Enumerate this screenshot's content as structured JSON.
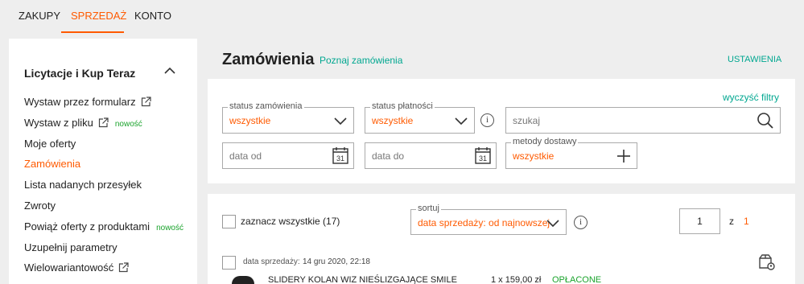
{
  "top_nav": {
    "tabs": [
      {
        "label": "ZAKUPY"
      },
      {
        "label": "SPRZEDAŻ"
      },
      {
        "label": "KONTO"
      }
    ]
  },
  "sidebar": {
    "title": "Licytacje i Kup Teraz",
    "items": [
      {
        "label": "Wystaw przez formularz"
      },
      {
        "label": "Wystaw z pliku",
        "badge": "nowość"
      },
      {
        "label": "Moje oferty"
      },
      {
        "label": "Zamówienia"
      },
      {
        "label": "Lista nadanych przesyłek"
      },
      {
        "label": "Zwroty"
      },
      {
        "label": "Powiąż oferty z produktami",
        "badge": "nowość"
      },
      {
        "label": "Uzupełnij parametry"
      },
      {
        "label": "Wielowariantowość"
      }
    ]
  },
  "header": {
    "title": "Zamówienia",
    "learn_link": "Poznaj zamówienia",
    "settings_link": "USTAWIENIA"
  },
  "filters": {
    "clear_label": "wyczyść filtry",
    "order_status": {
      "label": "status zamówienia",
      "value": "wszystkie"
    },
    "payment_status": {
      "label": "status płatności",
      "value": "wszystkie"
    },
    "search": {
      "placeholder": "szukaj"
    },
    "date_from": {
      "placeholder": "data od"
    },
    "date_to": {
      "placeholder": "data do"
    },
    "delivery": {
      "label": "metody dostawy",
      "value": "wszystkie"
    },
    "calendar_day": "31",
    "info_symbol": "i"
  },
  "list": {
    "select_all": "zaznacz wszystkie (17)",
    "sort": {
      "label": "sortuj",
      "value": "data sprzedaży: od najnowszej"
    },
    "page": "1",
    "of_label": "z",
    "total_pages": "1",
    "orders": [
      {
        "date_label": "data sprzedaży:",
        "date": "14 gru 2020, 22:18",
        "title": "SLIDERY KOLAN WIZ NIEŚLIZGAJĄCE SMILE",
        "price": "1 x 159,00 zł",
        "status": "OPŁACONE"
      }
    ]
  },
  "colors": {
    "accent": "#ff5a00",
    "link": "#00a790",
    "badge": "#1aa32c"
  },
  "icons": [
    "external-link-icon",
    "chevron-up-icon",
    "chevron-down-icon",
    "info-icon",
    "search-icon",
    "calendar-icon",
    "plus-icon",
    "package-icon"
  ]
}
